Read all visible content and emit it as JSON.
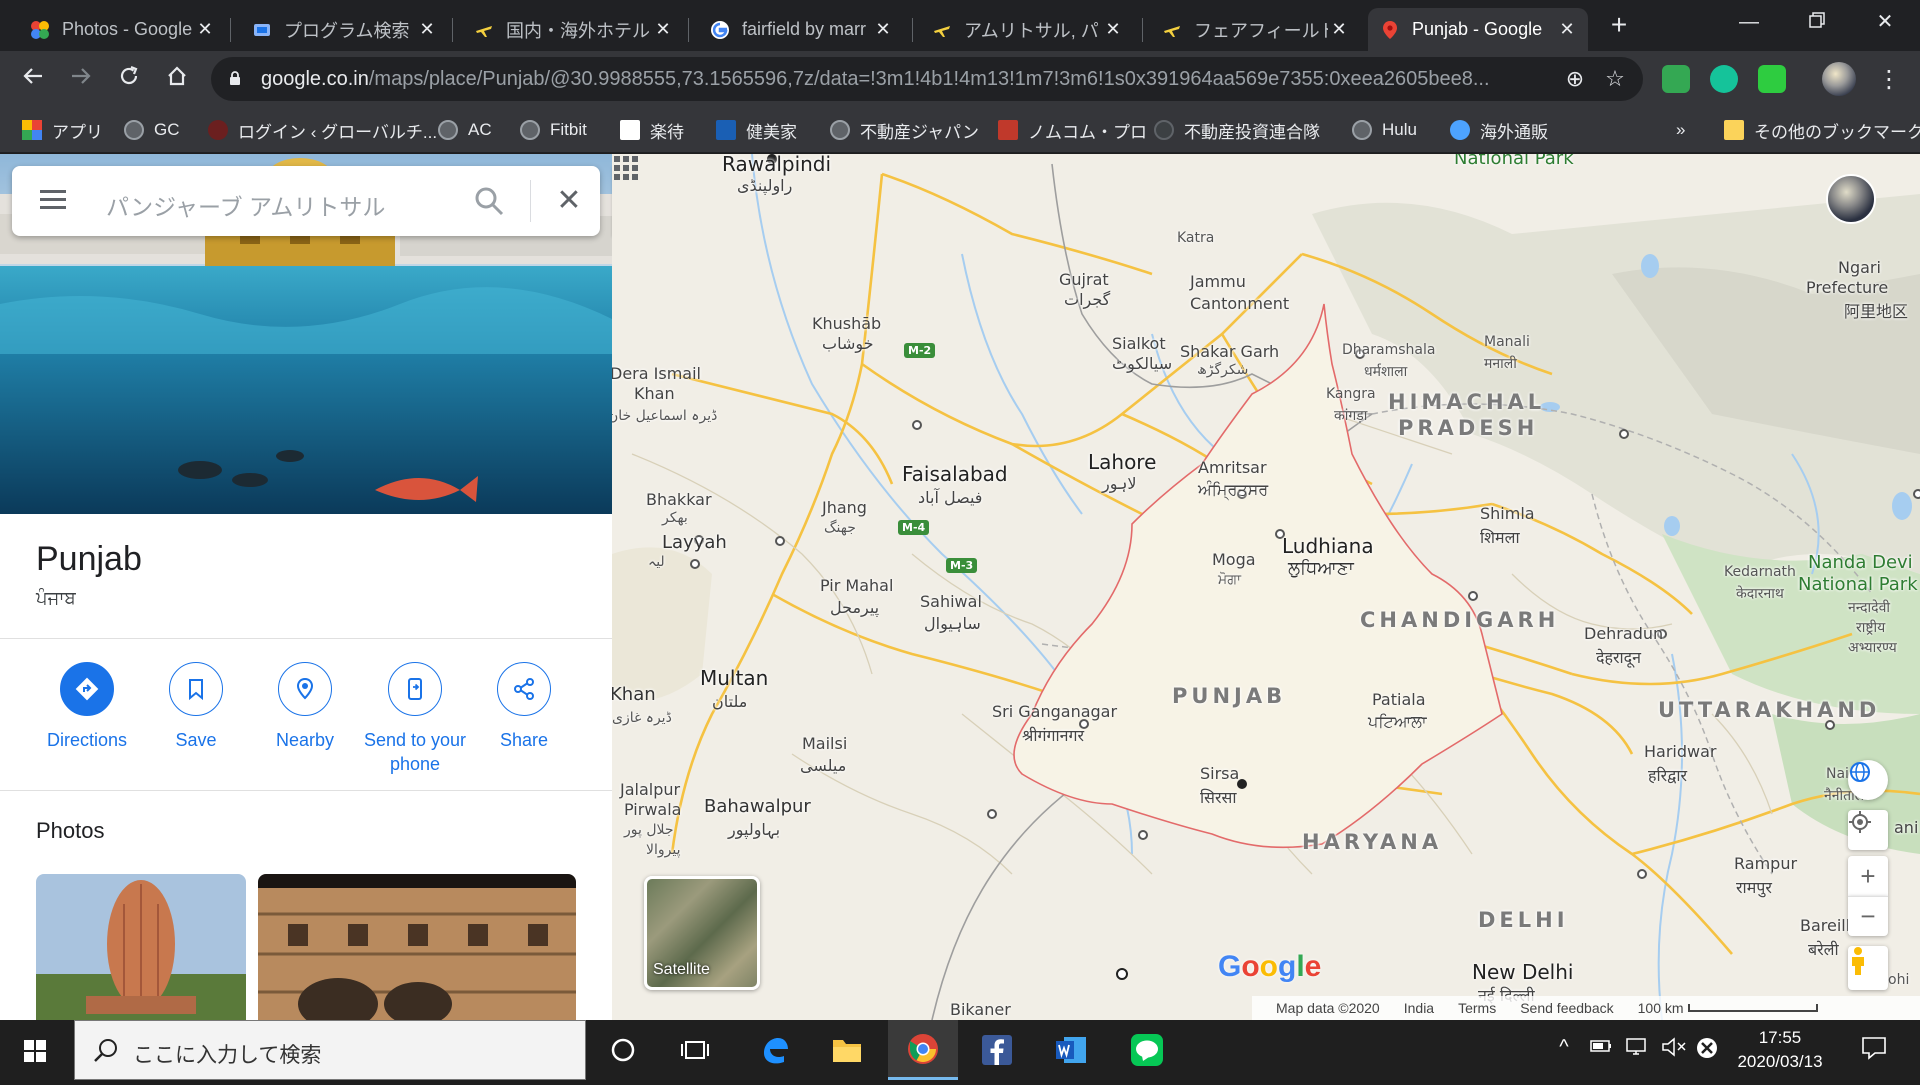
{
  "browser": {
    "tabs": [
      {
        "title": "Photos - Google",
        "icon": "google-photos-icon",
        "color": "#fbbc04",
        "active": false
      },
      {
        "title": "プログラム検索",
        "icon": "program-search-icon",
        "color": "#1a73e8",
        "active": false
      },
      {
        "title": "国内・海外ホテル",
        "icon": "hotel-icon",
        "color": "#f4d03f",
        "active": false
      },
      {
        "title": "fairfield by marr",
        "icon": "google-icon",
        "color": "#4285f4",
        "active": false
      },
      {
        "title": "アムリトサル, パン",
        "icon": "travel-icon",
        "color": "#f4d03f",
        "active": false
      },
      {
        "title": "フェアフィールド バ",
        "icon": "travel-icon",
        "color": "#f4d03f",
        "active": false
      },
      {
        "title": "Punjab - Google",
        "icon": "google-maps-icon",
        "color": "#34a853",
        "active": true
      }
    ],
    "url_host": "google.co.in",
    "url_path": "/maps/place/Punjab/@30.9988555,73.1565596,7z/data=!3m1!4b1!4m13!1m7!3m6!1s0x391964aa569e7355:0xeea2605bee8...",
    "bookmarks": [
      {
        "label": "アプリ",
        "icon": "apps-grid-icon",
        "color": "#ea4335"
      },
      {
        "label": "GC",
        "icon": "globe-icon",
        "color": "#9aa0a6"
      },
      {
        "label": "ログイン ‹ グローバルチ...",
        "icon": "bookmark-site-icon",
        "color": "#b03a2e"
      },
      {
        "label": "AC",
        "icon": "globe-icon",
        "color": "#9aa0a6"
      },
      {
        "label": "Fitbit",
        "icon": "globe-icon",
        "color": "#9aa0a6"
      },
      {
        "label": "楽待",
        "icon": "rakumachi-icon",
        "color": "#ffffff"
      },
      {
        "label": "健美家",
        "icon": "kenbiya-icon",
        "color": "#1a5fb4"
      },
      {
        "label": "不動産ジャパン",
        "icon": "globe-icon",
        "color": "#9aa0a6"
      },
      {
        "label": "ノムコム・プロ",
        "icon": "nomucom-icon",
        "color": "#c0392b"
      },
      {
        "label": "不動産投資連合隊",
        "icon": "globe-icon",
        "color": "#5f6368"
      },
      {
        "label": "Hulu",
        "icon": "globe-icon",
        "color": "#9aa0a6"
      },
      {
        "label": "海外通販",
        "icon": "world-icon",
        "color": "#4da3ff"
      }
    ],
    "bookmarks_overflow": "»",
    "other_bookmarks": "その他のブックマーク"
  },
  "panel": {
    "search_placeholder": "パンジャーブ アムリトサル",
    "title": "Punjab",
    "subtitle": "ਪੰਜਾਬ",
    "actions": [
      {
        "label": "Directions",
        "icon": "directions-icon"
      },
      {
        "label": "Save",
        "icon": "bookmark-icon"
      },
      {
        "label": "Nearby",
        "icon": "nearby-icon"
      },
      {
        "label": "Send to your phone",
        "icon": "send-to-phone-icon"
      },
      {
        "label": "Share",
        "icon": "share-icon"
      }
    ],
    "photos_heading": "Photos"
  },
  "map": {
    "labels": {
      "rawalpindi": "Rawalpindi",
      "rawalpindi_ur": "راولپنڈی",
      "national_park_top": "National Park",
      "katra": "Katra",
      "jammu": "Jammu",
      "cantonment": "Cantonment",
      "gujrat": "Gujrat",
      "gujrat_ur": "گجرات",
      "khushab": "Khushāb",
      "khushab_ur": "خوشاب",
      "sialkot": "Sialkot",
      "sialkot_ur": "سیالکوٹ",
      "shakar_garh": "Shakar Garh",
      "shakar_garh_ur": "شکرگڑھ",
      "dharamshala": "Dharamshala",
      "dharamshala_hi": "धर्मशाला",
      "kangra": "Kangra",
      "kangra_hi": "कांगड़ा",
      "manali": "Manali",
      "manali_hi": "मनाली",
      "himachal": "HIMACHAL",
      "pradesh": "PRADESH",
      "ngari": "Ngari",
      "prefecture": "Prefecture",
      "ngari_zh": "阿里地区",
      "dera_ismail": "Dera Ismail",
      "khan": "Khan",
      "dera_ismail_ur": "ڈیرہ اسماعیل خان",
      "faisalabad": "Faisalabad",
      "faisalabad_ur": "فیصل آباد",
      "lahore": "Lahore",
      "lahore_ur": "لاہور",
      "amritsar": "Amritsar",
      "amritsar_pa": "ਅੰਮ੍ਰਿਤਸਰ",
      "bhakkar": "Bhakkar",
      "bhakkar_ur": "بھکر",
      "jhang": "Jhang",
      "jhang_ur": "جھنگ",
      "layyah": "Layyah",
      "layyah_ur": "لیہ",
      "shimla": "Shimla",
      "shimla_hi": "शिमला",
      "ludhiana": "Ludhiana",
      "ludhiana_pa": "ਲੁਧਿਆਣਾ",
      "moga": "Moga",
      "moga_pa": "ਮੋਗਾ",
      "pir_mahal": "Pir Mahal",
      "pir_mahal_ur": "پیرمحل",
      "sahiwal": "Sahiwal",
      "sahiwal_ur": "ساہیوال",
      "kedarnath": "Kedarnath",
      "kedarnath_hi": "केदारनाथ",
      "nanda_devi": "Nanda Devi",
      "national_park": "National Park",
      "nanda_devi_hi": "नन्दादेवी",
      "nanda_devi_hi2": "राष्ट्रीय",
      "nanda_devi_hi3": "अभ्यारण्य",
      "chandigarh": "CHANDIGARH",
      "dehradun": "Dehradun",
      "dehradun_hi": "देहरादून",
      "multan": "Multan",
      "multan_ur": "ملتان",
      "khan_left": "Khan",
      "ghazi_ur": "ڈیرہ غازی",
      "sri_ganganagar": "Sri Ganganagar",
      "sri_ganganagar_hi": "श्रीगंगानगर",
      "punjab": "PUNJAB",
      "patiala": "Patiala",
      "patiala_pa": "ਪਟਿਆਲਾ",
      "uttarakhand": "UTTARAKHAND",
      "mailsi": "Mailsi",
      "mailsi_ur": "میلسی",
      "haridwar": "Haridwar",
      "haridwar_hi": "हरिद्वार",
      "sirsa": "Sirsa",
      "sirsa_hi": "सिरसा",
      "nainital": "Nainita",
      "nainital_hi": "नैनीताल",
      "jalalpur": "Jalalpur",
      "pirwala": "Pirwala",
      "jalalpur_ur": "جلال پور",
      "pirwala_ur": "پیروالا",
      "bahawalpur": "Bahawalpur",
      "bahawalpur_ur": "بہاولپور",
      "haryana": "HARYANA",
      "rampur": "Rampur",
      "rampur_hi": "रामपुर",
      "h_ani": "H",
      "ani": "ani",
      "delhi": "DELHI",
      "new_delhi": "New Delhi",
      "new_delhi_hi": "नई दिल्ली",
      "bareilly": "Bareill",
      "bareilly_hi": "बरेली",
      "bikaner": "Bikaner",
      "ohi": "ohi"
    },
    "highways": [
      "M-2",
      "M-4",
      "M-3"
    ],
    "satellite_label": "Satellite",
    "google_logo": "Google",
    "footer": {
      "map_data": "Map data ©2020",
      "country": "India",
      "terms": "Terms",
      "feedback": "Send feedback",
      "scale": "100 km"
    }
  },
  "taskbar": {
    "search_placeholder": "ここに入力して検索",
    "time": "17:55",
    "date": "2020/03/13"
  }
}
